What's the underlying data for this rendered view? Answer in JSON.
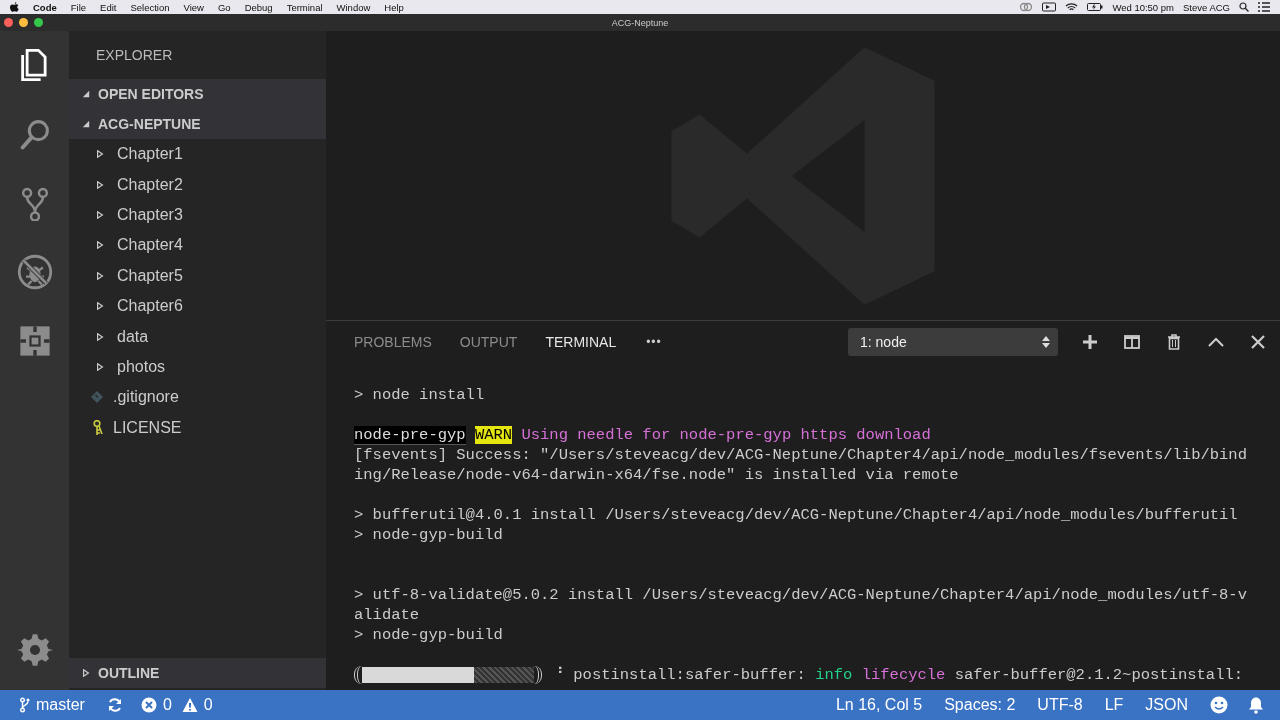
{
  "menu_bar": {
    "app_name": "Code",
    "items": [
      "File",
      "Edit",
      "Selection",
      "View",
      "Go",
      "Debug",
      "Terminal",
      "Window",
      "Help"
    ],
    "clock": "Wed 10:50 pm",
    "user": "Steve ACG"
  },
  "window": {
    "title": "ACG-Neptune"
  },
  "activity_bar": {
    "items": [
      {
        "kind": "files",
        "selected": true
      },
      {
        "kind": "search",
        "selected": false
      },
      {
        "kind": "source-control",
        "selected": false
      },
      {
        "kind": "debug",
        "selected": false
      },
      {
        "kind": "extensions",
        "selected": false
      }
    ]
  },
  "sidebar": {
    "title": "EXPLORER",
    "sections": [
      {
        "label": "OPEN EDITORS",
        "expanded": true
      },
      {
        "label": "ACG-NEPTUNE",
        "expanded": true,
        "items": [
          {
            "kind": "folder",
            "label": "Chapter1",
            "expanded": false
          },
          {
            "kind": "folder",
            "label": "Chapter2",
            "expanded": false
          },
          {
            "kind": "folder",
            "label": "Chapter3",
            "expanded": false
          },
          {
            "kind": "folder",
            "label": "Chapter4",
            "expanded": false
          },
          {
            "kind": "folder",
            "label": "Chapter5",
            "expanded": false
          },
          {
            "kind": "folder",
            "label": "Chapter6",
            "expanded": false
          },
          {
            "kind": "folder",
            "label": "data",
            "expanded": false
          },
          {
            "kind": "folder",
            "label": "photos",
            "expanded": false
          },
          {
            "kind": "git-file",
            "label": ".gitignore"
          },
          {
            "kind": "license-file",
            "label": "LICENSE"
          }
        ]
      }
    ],
    "outline": {
      "label": "OUTLINE",
      "expanded": false
    }
  },
  "panel": {
    "tabs": [
      {
        "label": "PROBLEMS",
        "selected": false
      },
      {
        "label": "OUTPUT",
        "selected": false
      },
      {
        "label": "TERMINAL",
        "selected": true
      }
    ],
    "more": "•••",
    "terminal_select": "1: node",
    "terminal": {
      "lines": [
        {
          "kind": "text",
          "segments": [
            {
              "kind": "plain",
              "text": "> node install"
            }
          ]
        },
        {
          "kind": "blank"
        },
        {
          "kind": "text",
          "segments": [
            {
              "kind": "heading",
              "text": "node-pre-gyp"
            },
            {
              "kind": "warn",
              "text": "WARN"
            },
            {
              "kind": "magenta",
              "text": " Using needle for node-pre-gyp https download"
            }
          ]
        },
        {
          "kind": "text",
          "segments": [
            {
              "kind": "plain",
              "text": "[fsevents] Success: \"/Users/steveacg/dev/ACG-Neptune/Chapter4/api/node_modules/fsevents/lib/binding/Release/node-v64-darwin-x64/fse.node\" is installed via remote"
            }
          ]
        },
        {
          "kind": "blank"
        },
        {
          "kind": "text",
          "segments": [
            {
              "kind": "plain",
              "text": "> bufferutil@4.0.1 install /Users/steveacg/dev/ACG-Neptune/Chapter4/api/node_modules/bufferutil"
            }
          ]
        },
        {
          "kind": "text",
          "segments": [
            {
              "kind": "plain",
              "text": "> node-gyp-build"
            }
          ]
        },
        {
          "kind": "blank"
        },
        {
          "kind": "blank"
        },
        {
          "kind": "text",
          "segments": [
            {
              "kind": "plain",
              "text": "> utf-8-validate@5.0.2 install /Users/steveacg/dev/ACG-Neptune/Chapter4/api/node_modules/utf-8-validate"
            }
          ]
        },
        {
          "kind": "text",
          "segments": [
            {
              "kind": "plain",
              "text": "> node-gyp-build"
            }
          ]
        },
        {
          "kind": "blank"
        },
        {
          "kind": "progress",
          "level": 0.65,
          "segments": [
            {
              "kind": "plain",
              "text": "⠘ postinstall:safer-buffer: "
            },
            {
              "kind": "green",
              "text": "info"
            },
            {
              "kind": "magenta",
              "text": " lifecycle"
            },
            {
              "kind": "plain",
              "text": " safer-buffer@2.1.2~postinstall:"
            }
          ]
        }
      ]
    }
  },
  "status_bar": {
    "branch": "master",
    "errors": "0",
    "warnings": "0",
    "right": [
      "Ln 16, Col 5",
      "Spaces: 2",
      "UTF-8",
      "LF",
      "JSON"
    ]
  }
}
